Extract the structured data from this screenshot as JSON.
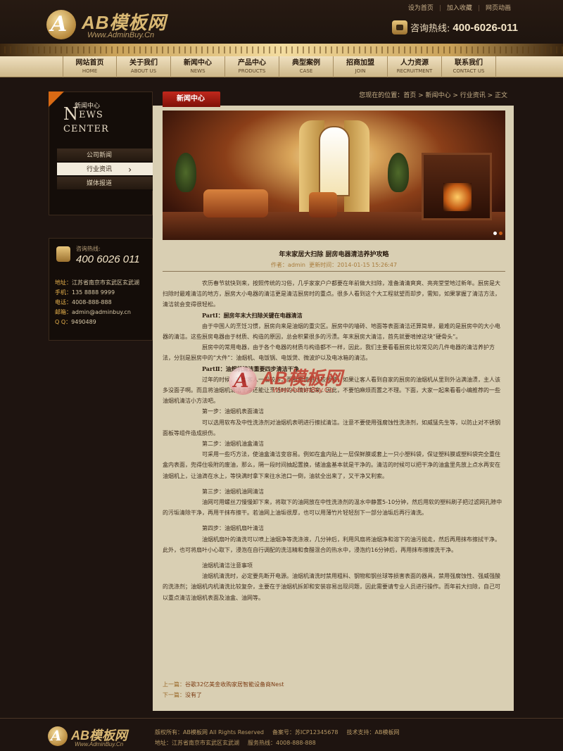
{
  "header": {
    "logo_text": "AB模板网",
    "logo_letter": "A",
    "logo_url": "Www.AdminBuy.Cn",
    "top_links": [
      "设为首页",
      "加入收藏",
      "网页动画"
    ],
    "hotline_label": "咨询热线:",
    "hotline_number": "400-6026-011"
  },
  "nav": [
    {
      "cn": "网站首页",
      "en": "HOME"
    },
    {
      "cn": "关于我们",
      "en": "ABOUT US"
    },
    {
      "cn": "新闻中心",
      "en": "NEWS"
    },
    {
      "cn": "产品中心",
      "en": "PRODUCTS"
    },
    {
      "cn": "典型案例",
      "en": "CASE"
    },
    {
      "cn": "招商加盟",
      "en": "JOIN"
    },
    {
      "cn": "人力资源",
      "en": "RECRUITMENT"
    },
    {
      "cn": "联系我们",
      "en": "CONTACT US"
    }
  ],
  "sidebar": {
    "title_cn": "新闻中心",
    "title_en_first": "N",
    "title_en_rest": "EWS CENTER",
    "items": [
      "公司新闻",
      "行业资讯",
      "媒体报道"
    ],
    "active_index": 1,
    "contact_label": "咨询热线:",
    "contact_number": "400 6026 011",
    "contact_lines": [
      {
        "label": "地址：",
        "value": "江苏省南京市玄武区玄武湖"
      },
      {
        "label": "手机：",
        "value": "135 8888 9999"
      },
      {
        "label": "电话：",
        "value": "4008-888-888"
      },
      {
        "label": "邮箱：",
        "value": "admin@adminbuy.cn"
      },
      {
        "label": "Q Q：",
        "value": "9490489"
      }
    ]
  },
  "main": {
    "tab_label": "新闻中心",
    "breadcrumb": "您现在的位置：首页 > 新闻中心 > 行业资讯 > 正文",
    "article": {
      "title": "年末家居大扫除 厨房电器清洁养护攻略",
      "author_label": "作者：",
      "author": "admin",
      "updated_label": "更新时间：",
      "updated": "2014-01-15 15:26:47",
      "paragraphs": [
        {
          "text": "农历春节就快到来，按照传统的习俗，几乎家家户户都要在年前做大扫除，准备清清爽爽、亮亮堂堂地过新年。厨房是大扫除时最难清洁的地方，厨房大小电器的清洁更是清洁厨房时的重点。很多人看到这个大工程就望而却步，需知，如果掌握了清洁方法，清洁就会变得很轻松。",
          "h": false,
          "gap": false
        },
        {
          "text": "PartⅠ：厨房年末大扫除关键在电器清洁",
          "h": true,
          "gap": false
        },
        {
          "text": "由于中国人的烹饪习惯，厨房向来是油烟的重灾区。厨房中的墙砖、地面等表面清洁还算简单，最难的是厨房中的大小电器的清洁。这些厨房电器由于材质、构造的原因，总会积累很多的污渍。年末厨房大清洁，首先就要啃掉这块“硬骨头”。",
          "h": false,
          "gap": false
        },
        {
          "text": "厨房中的常用电器，由于各个电器的材质与构造都不一样，因此，我们主要看看厨房比较常见的几件电器的清洁养护方法，分别是厨房中的“大件”：油烟机、电饭锅、电饭煲、微波炉以及电冰箱的清洁。",
          "h": false,
          "gap": false
        },
        {
          "text": "PartⅡ：油烟机清洁重要四步清洁干净",
          "h": true,
          "gap": false
        },
        {
          "text": "过年的时候，家里客人一般较多，而厨房使用也较频繁，如果让客人看到自家的厨房的油烟机从里到外沾满油渍，主人该多没面子啊。而且将油烟机清洁干净还能让烹饪时的心情好起来，因此，不要怕麻烦而置之不理。下面，大家一起来看看小编推荐的一些油烟机清洁小方法吧。",
          "h": false,
          "gap": false
        },
        {
          "text": "第一步：油烟机表面清洁",
          "h": false,
          "gap": false
        },
        {
          "text": "可以选用软布及中性洗涤剂对油烟机表明进行擦拭清洁。注意不要使用强腐蚀性洗涤剂，如威猛先生等，以防止对不锈钢面板等组件造成损伤。",
          "h": false,
          "gap": false
        },
        {
          "text": "第二步：油烟机油盒清洁",
          "h": false,
          "gap": false
        },
        {
          "text": "可采用一些巧方法，使油盒清洁变容易。例如在盒内贴上一层保鲜膜或套上一只小塑料袋，保证塑料膜或塑料袋完全重住盒内表面，兜得住吸附的废油，那么，隔一段时间抽起置换，储油盒基本就是干净的。清洁的时候可以把干净的油盒里先放上点水再安在油烟机上，让油滴在水上，等快满时拿下来往水池口一倒，油就全出来了，又干净又利索。",
          "h": false,
          "gap": false
        },
        {
          "text": "第三步：油烟机油网清洁",
          "h": false,
          "gap": true
        },
        {
          "text": "油网可用螺丝刀慢慢卸下来，将取下的油网放在中性洗涤剂的温水中静置5-10分钟，然后用软的塑料刷子把过滤网孔隙中的污垢清除干净，再用干抹布擦干。若油网上油垢很厚，也可以用薄竹片轻轻刮下一部分油垢后再行清洗。",
          "h": false,
          "gap": false
        },
        {
          "text": "第四步：油烟机扇叶清洁",
          "h": false,
          "gap": true
        },
        {
          "text": "油烟机扇叶的清洗可以喷上油烟净等洗涤液，几分钟后，利用风扇将油烟净和溶下的油污抛走，然后再用抹布擦拭干净。此外，也可将扇叶小心取下，浸泡在自行调配的洗洁精和食醋混合的热水中，浸泡约16分钟后，再用抹布擦擦洗干净。",
          "h": false,
          "gap": false
        },
        {
          "text": "油烟机清洁注意事项",
          "h": false,
          "gap": true
        },
        {
          "text": "油烟机清洗时，必定要先断开电源。油烟机清洗时禁用粗料、钢物和钢丝球等损害表面的器具，禁用强腐蚀性、强威强酸的洗涤剂；油烟机内机清洗比较复杂，主要在于油烟机拆卸和安装容易出现问题，因此需要请专业人员进行操作。而年前大扫除，自己可以重点清洁油烟机表面及油盒、油网等。",
          "h": false,
          "gap": false
        }
      ],
      "prev_label": "上一篇：",
      "prev_title": "谷歌32亿美金收购家居智能设备商Nest",
      "next_label": "下一篇：",
      "next_title": "没有了"
    }
  },
  "watermark": {
    "letter": "A",
    "text": "AB模板网",
    "sub": "Www.AdminBuy.Cn"
  },
  "footer": {
    "logo_text": "AB模板网",
    "logo_letter": "A",
    "logo_url": "Www.AdminBuy.Cn",
    "line1": [
      "版权所有：AB模板网 All Rights Reserved",
      "备案号：苏ICP12345678",
      "技术支持：AB模板网"
    ],
    "line2": [
      "地址：江苏省南京市玄武区玄武湖",
      "服务热线：4008-888-888"
    ]
  },
  "colors": {
    "background": "#1e1410",
    "content": "#d9cfb3",
    "accent_gold": "#d9b873",
    "tab_red": "#a81c12",
    "corner_orange": "#d86a14"
  }
}
